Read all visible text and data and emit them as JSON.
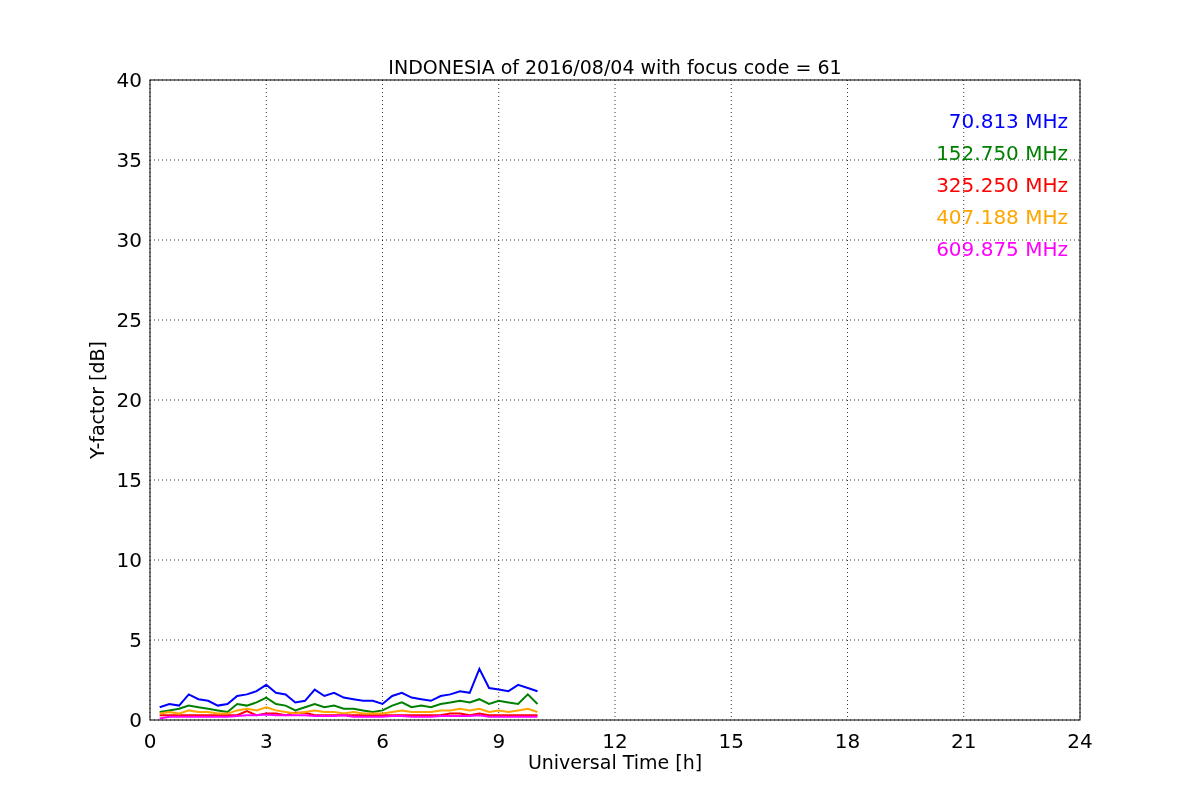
{
  "figure": {
    "chart_data": {
      "type": "line",
      "title": "INDONESIA of 2016/08/04 with focus code = 61",
      "xlabel": "Universal Time [h]",
      "ylabel": "Y-factor [dB]",
      "x": [
        0.25,
        0.5,
        0.75,
        1,
        1.25,
        1.5,
        1.75,
        2,
        2.25,
        2.5,
        2.75,
        3,
        3.25,
        3.5,
        3.75,
        4,
        4.25,
        4.5,
        4.75,
        5,
        5.25,
        5.5,
        5.75,
        6,
        6.25,
        6.5,
        6.75,
        7,
        7.25,
        7.5,
        7.75,
        8,
        8.25,
        8.5,
        8.75,
        9,
        9.25,
        9.5,
        9.75,
        10
      ],
      "series": [
        {
          "name": "70.813 MHz",
          "color": "#0000ff",
          "values": [
            0.8,
            1.0,
            0.9,
            1.6,
            1.3,
            1.2,
            0.9,
            1.0,
            1.5,
            1.6,
            1.8,
            2.2,
            1.7,
            1.6,
            1.1,
            1.2,
            1.9,
            1.5,
            1.7,
            1.4,
            1.3,
            1.2,
            1.2,
            1.0,
            1.5,
            1.7,
            1.4,
            1.3,
            1.2,
            1.5,
            1.6,
            1.8,
            1.7,
            3.2,
            2.0,
            1.9,
            1.8,
            2.2,
            2.0,
            1.8
          ]
        },
        {
          "name": "152.750 MHz",
          "color": "#008000",
          "values": [
            0.5,
            0.6,
            0.7,
            0.9,
            0.8,
            0.7,
            0.6,
            0.5,
            1.0,
            0.9,
            1.1,
            1.4,
            1.0,
            0.9,
            0.6,
            0.8,
            1.0,
            0.8,
            0.9,
            0.7,
            0.7,
            0.6,
            0.5,
            0.6,
            0.9,
            1.1,
            0.8,
            0.9,
            0.8,
            1.0,
            1.1,
            1.2,
            1.1,
            1.3,
            1.0,
            1.2,
            1.1,
            1.0,
            1.6,
            1.0
          ]
        },
        {
          "name": "325.250 MHz",
          "color": "#ff0000",
          "values": [
            0.3,
            0.3,
            0.3,
            0.3,
            0.3,
            0.3,
            0.3,
            0.3,
            0.3,
            0.55,
            0.3,
            0.4,
            0.4,
            0.3,
            0.45,
            0.45,
            0.3,
            0.3,
            0.3,
            0.3,
            0.3,
            0.3,
            0.3,
            0.3,
            0.3,
            0.3,
            0.3,
            0.3,
            0.3,
            0.3,
            0.4,
            0.4,
            0.3,
            0.4,
            0.3,
            0.3,
            0.3,
            0.3,
            0.3,
            0.3
          ]
        },
        {
          "name": "407.188 MHz",
          "color": "#ffa500",
          "values": [
            0.4,
            0.5,
            0.4,
            0.6,
            0.5,
            0.5,
            0.4,
            0.4,
            0.6,
            0.7,
            0.6,
            0.8,
            0.6,
            0.5,
            0.4,
            0.5,
            0.6,
            0.5,
            0.5,
            0.4,
            0.5,
            0.4,
            0.4,
            0.4,
            0.5,
            0.6,
            0.5,
            0.5,
            0.5,
            0.6,
            0.6,
            0.7,
            0.6,
            0.7,
            0.5,
            0.6,
            0.5,
            0.6,
            0.7,
            0.5
          ]
        },
        {
          "name": "609.875 MHz",
          "color": "#ff00ff",
          "values": [
            0.1,
            0.2,
            0.2,
            0.2,
            0.2,
            0.2,
            0.2,
            0.2,
            0.25,
            0.3,
            0.3,
            0.35,
            0.3,
            0.3,
            0.3,
            0.3,
            0.25,
            0.25,
            0.25,
            0.3,
            0.2,
            0.2,
            0.2,
            0.2,
            0.25,
            0.25,
            0.2,
            0.2,
            0.2,
            0.25,
            0.25,
            0.25,
            0.25,
            0.3,
            0.2,
            0.2,
            0.2,
            0.2,
            0.2,
            0.2
          ]
        }
      ],
      "xlim": [
        0,
        24
      ],
      "ylim": [
        0,
        40
      ],
      "xticks": [
        0,
        3,
        6,
        9,
        12,
        15,
        18,
        21,
        24
      ],
      "yticks": [
        0,
        5,
        10,
        15,
        20,
        25,
        30,
        35,
        40
      ],
      "grid": true
    }
  }
}
